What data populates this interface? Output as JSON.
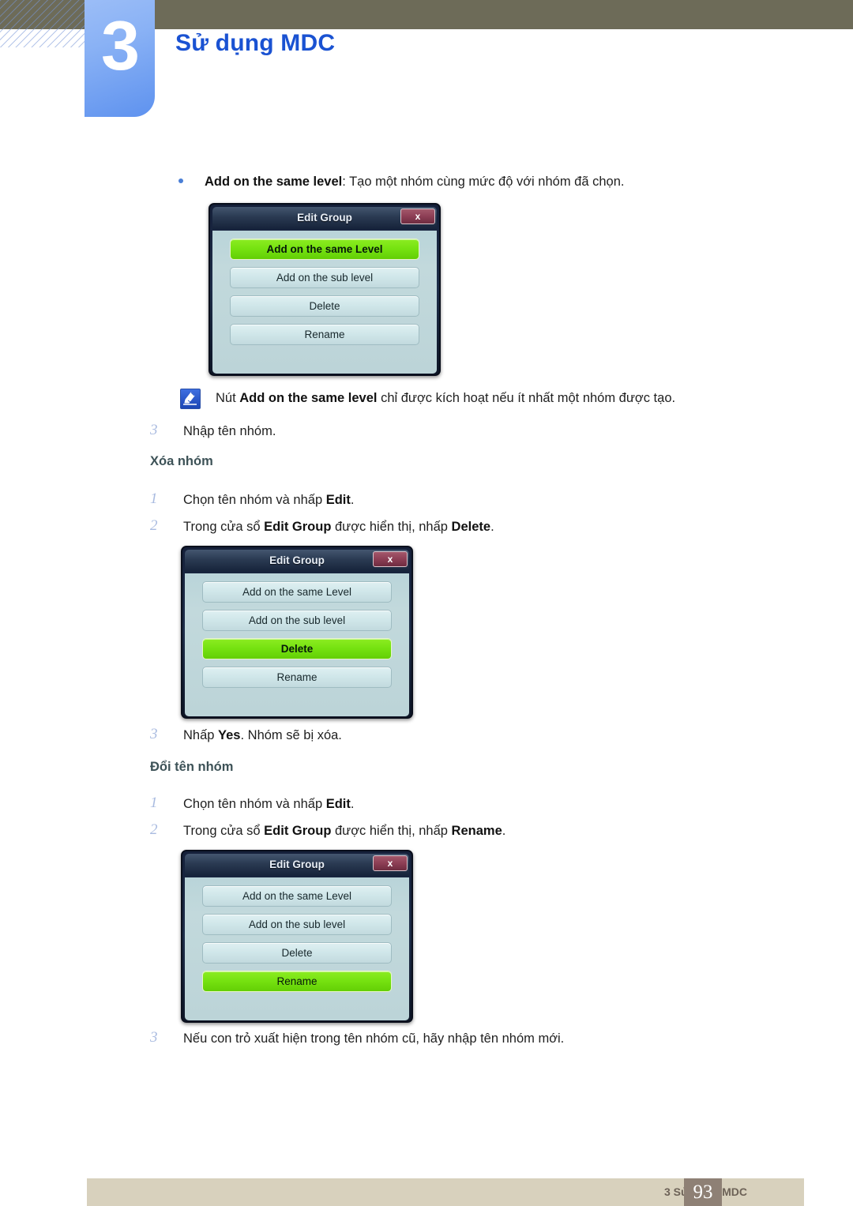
{
  "header": {
    "chapter_number": "3",
    "chapter_title": "Sử dụng MDC",
    "bar_color": "#6d6b58",
    "accent_color": "#1a52d2"
  },
  "content": {
    "bullet": {
      "term": "Add on the same level",
      "separator": ": ",
      "description": "Tạo một nhóm cùng mức độ với nhóm đã chọn."
    },
    "note": {
      "icon": "note-pen-icon",
      "text_before": "Nút ",
      "term": "Add on the same level",
      "text_after": " chỉ được kích hoạt nếu ít nhất một nhóm được tạo."
    },
    "step_add_3": {
      "number": "3",
      "text": "Nhập tên nhóm."
    },
    "section_delete": {
      "heading": "Xóa nhóm",
      "steps": [
        {
          "number": "1",
          "pre": "Chọn tên nhóm và nhấp ",
          "bold": "Edit",
          "post": "."
        },
        {
          "number": "2",
          "pre": "Trong cửa sổ ",
          "bold": "Edit Group",
          "mid": " được hiển thị, nhấp ",
          "bold2": "Delete",
          "post": "."
        }
      ],
      "step3": {
        "number": "3",
        "pre": "Nhấp ",
        "bold": "Yes",
        "post": ". Nhóm sẽ bị xóa."
      }
    },
    "section_rename": {
      "heading": "Đổi tên nhóm",
      "steps": [
        {
          "number": "1",
          "pre": "Chọn tên nhóm và nhấp ",
          "bold": "Edit",
          "post": "."
        },
        {
          "number": "2",
          "pre": "Trong cửa sổ ",
          "bold": "Edit Group",
          "mid": " được hiển thị, nhấp ",
          "bold2": "Rename",
          "post": "."
        }
      ],
      "step3": {
        "number": "3",
        "text": "Nếu con trỏ xuất hiện trong tên nhóm cũ, hãy nhập tên nhóm mới."
      }
    }
  },
  "dialogs": [
    {
      "title": "Edit Group",
      "close_label": "x",
      "buttons": [
        {
          "label": "Add on the same Level",
          "highlighted": true
        },
        {
          "label": "Add on the sub level",
          "highlighted": false
        },
        {
          "label": "Delete",
          "highlighted": false
        },
        {
          "label": "Rename",
          "highlighted": false
        }
      ]
    },
    {
      "title": "Edit Group",
      "close_label": "x",
      "buttons": [
        {
          "label": "Add on the same Level",
          "highlighted": false
        },
        {
          "label": "Add on the sub level",
          "highlighted": false
        },
        {
          "label": "Delete",
          "highlighted": true
        },
        {
          "label": "Rename",
          "highlighted": false
        }
      ]
    },
    {
      "title": "Edit Group",
      "close_label": "x",
      "buttons": [
        {
          "label": "Add on the same Level",
          "highlighted": false
        },
        {
          "label": "Add on the sub level",
          "highlighted": false
        },
        {
          "label": "Delete",
          "highlighted": false
        },
        {
          "label": "Rename",
          "highlighted": true
        }
      ]
    }
  ],
  "footer": {
    "label": "3 Sử dụng MDC",
    "page_number": "93",
    "bar_color": "#d8d1bd",
    "page_box_color": "#8e8075"
  }
}
